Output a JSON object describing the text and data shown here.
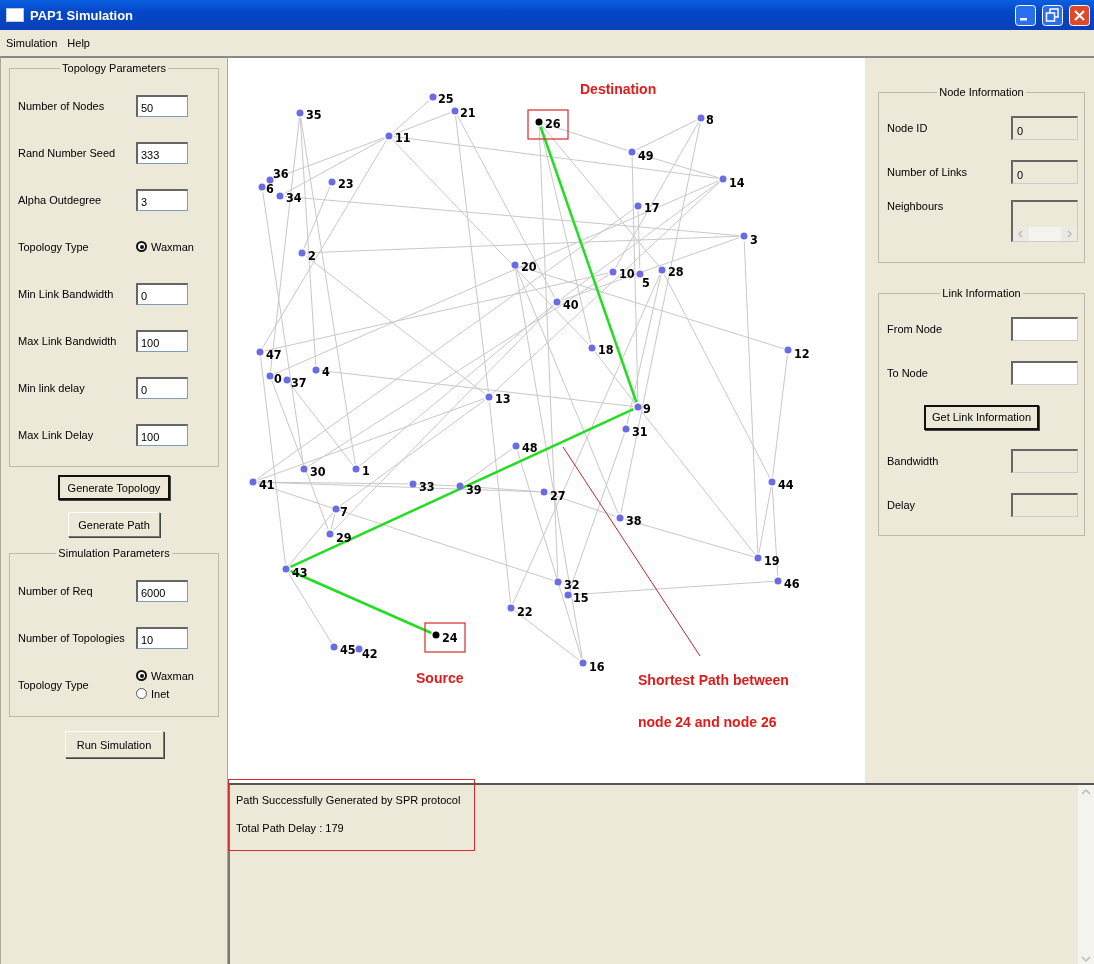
{
  "window": {
    "title": "PAP1 Simulation"
  },
  "menu": [
    {
      "label": "Simulation"
    },
    {
      "label": "Help"
    }
  ],
  "topology_parameters": {
    "title": "Topology Parameters",
    "fields": [
      {
        "kind": "text",
        "label": "Number of Nodes",
        "value": "50"
      },
      {
        "kind": "text",
        "label": "Rand Number Seed",
        "value": "333"
      },
      {
        "kind": "text",
        "label": "Alpha Outdegree",
        "value": "3"
      },
      {
        "kind": "radio",
        "label": "Topology Type",
        "options": [
          {
            "label": "Waxman",
            "selected": true
          }
        ]
      },
      {
        "kind": "text",
        "label": "Min Link Bandwidth",
        "value": "0"
      },
      {
        "kind": "text",
        "label": "Max Link Bandwidth",
        "value": "100"
      },
      {
        "kind": "text",
        "label": "Min link delay",
        "value": "0"
      },
      {
        "kind": "text",
        "label": "Max Link Delay",
        "value": "100"
      }
    ]
  },
  "actions": [
    {
      "label": "Generate Topology",
      "default": true
    },
    {
      "label": "Generate Path",
      "default": false
    }
  ],
  "simulation_parameters": {
    "title": "Simulation Parameters",
    "fields": [
      {
        "kind": "text",
        "label": "Number of Req",
        "value": "6000"
      },
      {
        "kind": "text",
        "label": "Number of Topologies",
        "value": "10"
      },
      {
        "kind": "radio",
        "label": "Topology Type",
        "options": [
          {
            "label": "Waxman",
            "selected": true
          },
          {
            "label": "Inet",
            "selected": false
          }
        ]
      }
    ]
  },
  "run_button": {
    "label": "Run Simulation",
    "default": false
  },
  "graph": {
    "nodes": [
      {
        "label": "25",
        "kind": "normal"
      },
      {
        "label": "35",
        "kind": "normal"
      },
      {
        "label": "21",
        "kind": "normal"
      },
      {
        "label": "26",
        "kind": "endpoint"
      },
      {
        "label": "8",
        "kind": "normal"
      },
      {
        "label": "11",
        "kind": "normal"
      },
      {
        "label": "49",
        "kind": "normal"
      },
      {
        "label": "6",
        "kind": "normal"
      },
      {
        "label": "36",
        "kind": "normal"
      },
      {
        "label": "23",
        "kind": "normal"
      },
      {
        "label": "14",
        "kind": "normal"
      },
      {
        "label": "34",
        "kind": "normal"
      },
      {
        "label": "17",
        "kind": "normal"
      },
      {
        "label": "3",
        "kind": "normal"
      },
      {
        "label": "2",
        "kind": "normal"
      },
      {
        "label": "20",
        "kind": "normal"
      },
      {
        "label": "10",
        "kind": "normal"
      },
      {
        "label": "5",
        "kind": "normal"
      },
      {
        "label": "28",
        "kind": "normal"
      },
      {
        "label": "40",
        "kind": "normal"
      },
      {
        "label": "47",
        "kind": "normal"
      },
      {
        "label": "18",
        "kind": "normal"
      },
      {
        "label": "12",
        "kind": "normal"
      },
      {
        "label": "0",
        "kind": "normal"
      },
      {
        "label": "37",
        "kind": "normal"
      },
      {
        "label": "4",
        "kind": "normal"
      },
      {
        "label": "13",
        "kind": "normal"
      },
      {
        "label": "9",
        "kind": "normal"
      },
      {
        "label": "31",
        "kind": "normal"
      },
      {
        "label": "48",
        "kind": "normal"
      },
      {
        "label": "30",
        "kind": "normal"
      },
      {
        "label": "1",
        "kind": "normal"
      },
      {
        "label": "41",
        "kind": "normal"
      },
      {
        "label": "33",
        "kind": "normal"
      },
      {
        "label": "39",
        "kind": "normal"
      },
      {
        "label": "27",
        "kind": "normal"
      },
      {
        "label": "44",
        "kind": "normal"
      },
      {
        "label": "7",
        "kind": "normal"
      },
      {
        "label": "38",
        "kind": "normal"
      },
      {
        "label": "29",
        "kind": "normal"
      },
      {
        "label": "19",
        "kind": "normal"
      },
      {
        "label": "43",
        "kind": "normal"
      },
      {
        "label": "32",
        "kind": "normal"
      },
      {
        "label": "46",
        "kind": "normal"
      },
      {
        "label": "15",
        "kind": "normal"
      },
      {
        "label": "22",
        "kind": "normal"
      },
      {
        "label": "24",
        "kind": "endpoint"
      },
      {
        "label": "45",
        "kind": "normal"
      },
      {
        "label": "42",
        "kind": "normal"
      },
      {
        "label": "16",
        "kind": "normal"
      }
    ],
    "shortest_path": {
      "shown": true
    },
    "annotations": [
      {
        "text": "Destination"
      },
      {
        "text": "Source"
      },
      {
        "text": "Shortest Path between"
      },
      {
        "text": "node 24 and node 26"
      }
    ]
  },
  "node_information": {
    "title": "Node Information",
    "fields": [
      {
        "kind": "text",
        "label": "Node ID",
        "value": "0",
        "disabled": true
      },
      {
        "kind": "text",
        "label": "Number of Links",
        "value": "0",
        "disabled": true
      },
      {
        "kind": "list",
        "label": "Neighbours",
        "disabled": true
      }
    ]
  },
  "link_information": {
    "title": "Link Information",
    "fields": [
      {
        "kind": "text",
        "label": "From Node",
        "disabled": false
      },
      {
        "kind": "text",
        "label": "To Node",
        "disabled": false
      },
      {
        "kind": "button",
        "label": "Get Link Information"
      },
      {
        "kind": "text",
        "label": "Bandwidth",
        "disabled": true
      },
      {
        "kind": "text",
        "label": "Delay",
        "disabled": true
      }
    ]
  },
  "log": {
    "lines": [
      "Path Successfully Generated by SPR protocol",
      "Total Path Delay : 179"
    ]
  }
}
